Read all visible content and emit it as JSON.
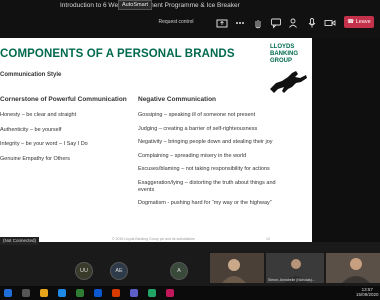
{
  "meeting": {
    "title": "Introduction to 6 Week Employment Programme & Ice Breaker",
    "autoshare_label": "AutoSmart",
    "request_control_label": "Request control",
    "leave_label": "Leave"
  },
  "slide": {
    "title": "COMPONENTS OF A PERSONAL BRANDS",
    "logo_line1": "LLOYDS",
    "logo_line2": "BANKING",
    "logo_line3": "GROUP",
    "subtitle": "Communication Style",
    "left_heading": "Cornerstone of Powerful Communication",
    "right_heading": "Negative Communication",
    "left_items": [
      "Honesty – be clear and straight",
      "Authenticity – be yourself",
      "Integrity – be your word – I Say I Do",
      "Genuine Empathy for Others"
    ],
    "right_items": [
      "Gossiping – speaking ill of someone not present",
      "Judging – creating a barrier of self-righteousness",
      "Negativity – bringing people down and stealing their joy",
      "Complaining – spreading misery in the world",
      "Excuses/blaming – not taking responsibility for actions",
      "Exaggeration/lying – distorting the truth about things and events",
      "Dogmatism - pushing hard for “my way or the highway”"
    ],
    "footer": "© 2015 Lloyds Banking Group plc and its subsidiaries",
    "page": "10"
  },
  "presenter_label": "(Not Connected)",
  "participants": {
    "avatars": [
      "UU",
      "AE",
      "A"
    ],
    "tiles": [
      "",
      "Simon, Annabelle (Nicholas)...",
      ""
    ]
  },
  "taskbar": {
    "time": "13:57",
    "date": "15/09/2020"
  },
  "colors": {
    "brand_green": "#006a4d",
    "leave_red": "#c4314b"
  }
}
